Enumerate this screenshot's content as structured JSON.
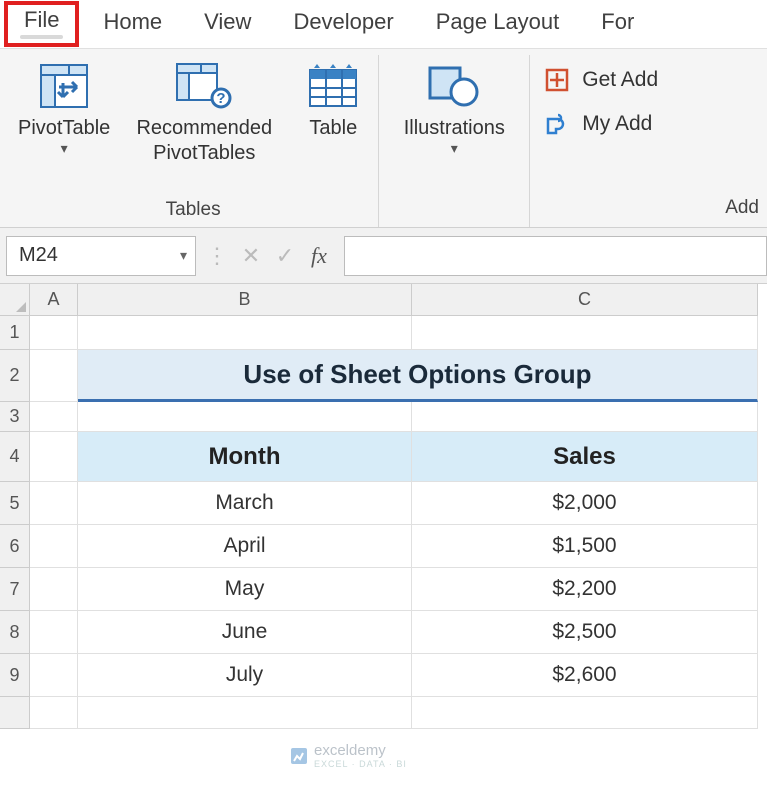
{
  "tabs": {
    "file": "File",
    "home": "Home",
    "view": "View",
    "developer": "Developer",
    "pagelayout": "Page Layout",
    "formulas_cut": "For"
  },
  "ribbon": {
    "tables": {
      "pivottable": "PivotTable",
      "recommended_l1": "Recommended",
      "recommended_l2": "PivotTables",
      "table": "Table",
      "group_label": "Tables"
    },
    "illustrations": {
      "label": "Illustrations"
    },
    "addins": {
      "get": "Get Add",
      "my": "My Add",
      "group_label_cut": "Add"
    }
  },
  "formula_bar": {
    "namebox": "M24"
  },
  "columns": {
    "A": "A",
    "B": "B",
    "C": "C"
  },
  "rows": [
    "1",
    "2",
    "3",
    "4",
    "5",
    "6",
    "7",
    "8",
    "9"
  ],
  "sheet": {
    "title": "Use of Sheet Options Group",
    "header_month": "Month",
    "header_sales": "Sales"
  },
  "chart_data": {
    "type": "table",
    "title": "Use of Sheet Options Group",
    "columns": [
      "Month",
      "Sales"
    ],
    "rows": [
      {
        "month": "March",
        "sales": "$2,000"
      },
      {
        "month": "April",
        "sales": "$1,500"
      },
      {
        "month": "May",
        "sales": "$2,200"
      },
      {
        "month": "June",
        "sales": "$2,500"
      },
      {
        "month": "July",
        "sales": "$2,600"
      }
    ]
  },
  "watermark": {
    "brand": "exceldemy",
    "tag": "EXCEL · DATA · BI"
  }
}
